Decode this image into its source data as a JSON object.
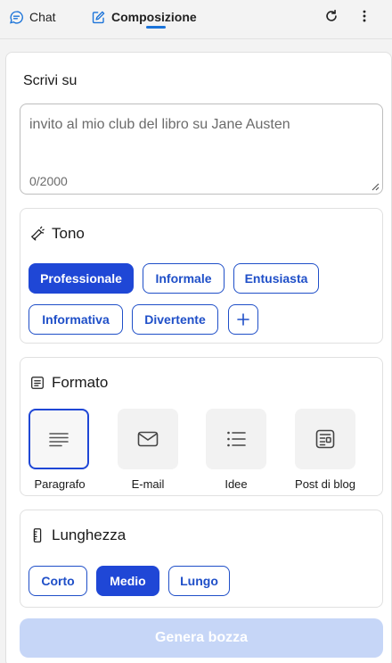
{
  "tabs": {
    "chat_label": "Chat",
    "compose_label": "Composizione"
  },
  "compose": {
    "write_label": "Scrivi su",
    "prompt_text": "invito al mio club del libro su Jane Austen",
    "counter": "0/2000"
  },
  "tone": {
    "title": "Tono",
    "options": [
      "Professionale",
      "Informale",
      "Entusiasta",
      "Informativa",
      "Divertente"
    ],
    "selected": "Professionale"
  },
  "format": {
    "title": "Formato",
    "options": [
      "Paragrafo",
      "E-mail",
      "Idee",
      "Post di blog"
    ],
    "selected": "Paragrafo"
  },
  "length": {
    "title": "Lunghezza",
    "options": [
      "Corto",
      "Medio",
      "Lungo"
    ],
    "selected": "Medio"
  },
  "generate_label": "Genera bozza",
  "colors": {
    "accent": "#1f47d6",
    "tab_underline": "#1a73d9",
    "generate_disabled": "#c6d6f7"
  },
  "icons": [
    "chat-icon",
    "compose-icon",
    "refresh-icon",
    "more-icon",
    "tone-icon",
    "format-icon",
    "length-icon",
    "paragraph-icon",
    "email-icon",
    "list-icon",
    "blog-icon",
    "plus-icon",
    "resize-handle-icon"
  ]
}
